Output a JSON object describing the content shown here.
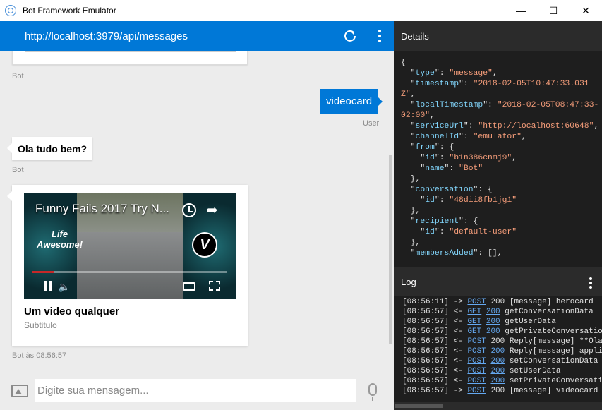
{
  "window": {
    "title": "Bot Framework Emulator",
    "controls": {
      "minimize": "—",
      "maximize": "☐",
      "close": "✕"
    }
  },
  "chat": {
    "url": "http://localhost:3979/api/messages",
    "messages": [
      {
        "from": "Bot",
        "label": "Bot"
      },
      {
        "from": "User",
        "text": "videocard",
        "label": "User"
      },
      {
        "from": "Bot",
        "text": "Ola tudo bem?",
        "label": "Bot"
      },
      {
        "from": "Bot",
        "card": {
          "video_title": "Funny Fails 2017 Try N...",
          "life_text": "Life\nAwesome!",
          "vine_logo": "V",
          "title": "Um video qualquer",
          "subtitle": "Subtitulo"
        },
        "label": "Bot às 08:56:57"
      }
    ],
    "input": {
      "placeholder": "Digite sua mensagem..."
    }
  },
  "details": {
    "title": "Details",
    "json_lines": [
      [
        [
          "p",
          "{"
        ]
      ],
      [
        [
          "p",
          "  \""
        ],
        [
          "k",
          "type"
        ],
        [
          "p",
          "\": "
        ],
        [
          "s",
          "\"message\""
        ],
        [
          "p",
          ","
        ]
      ],
      [
        [
          "p",
          "  \""
        ],
        [
          "k",
          "timestamp"
        ],
        [
          "p",
          "\": "
        ],
        [
          "s",
          "\"2018-02-05T10:47:33.031Z\""
        ],
        [
          "p",
          ","
        ]
      ],
      [
        [
          "p",
          "  \""
        ],
        [
          "k",
          "localTimestamp"
        ],
        [
          "p",
          "\": "
        ],
        [
          "s",
          "\"2018-02-05T08:47:33-02:00\""
        ],
        [
          "p",
          ","
        ]
      ],
      [
        [
          "p",
          "  \""
        ],
        [
          "k",
          "serviceUrl"
        ],
        [
          "p",
          "\": "
        ],
        [
          "s",
          "\"http://localhost:60648\""
        ],
        [
          "p",
          ","
        ]
      ],
      [
        [
          "p",
          "  \""
        ],
        [
          "k",
          "channelId"
        ],
        [
          "p",
          "\": "
        ],
        [
          "s",
          "\"emulator\""
        ],
        [
          "p",
          ","
        ]
      ],
      [
        [
          "p",
          "  \""
        ],
        [
          "k",
          "from"
        ],
        [
          "p",
          "\": {"
        ]
      ],
      [
        [
          "p",
          "    \""
        ],
        [
          "k",
          "id"
        ],
        [
          "p",
          "\": "
        ],
        [
          "s",
          "\"b1n386cnmj9\""
        ],
        [
          "p",
          ","
        ]
      ],
      [
        [
          "p",
          "    \""
        ],
        [
          "k",
          "name"
        ],
        [
          "p",
          "\": "
        ],
        [
          "s",
          "\"Bot\""
        ]
      ],
      [
        [
          "p",
          "  },"
        ]
      ],
      [
        [
          "p",
          "  \""
        ],
        [
          "k",
          "conversation"
        ],
        [
          "p",
          "\": {"
        ]
      ],
      [
        [
          "p",
          "    \""
        ],
        [
          "k",
          "id"
        ],
        [
          "p",
          "\": "
        ],
        [
          "s",
          "\"48dii8fb1jg1\""
        ]
      ],
      [
        [
          "p",
          "  },"
        ]
      ],
      [
        [
          "p",
          "  \""
        ],
        [
          "k",
          "recipient"
        ],
        [
          "p",
          "\": {"
        ]
      ],
      [
        [
          "p",
          "    \""
        ],
        [
          "k",
          "id"
        ],
        [
          "p",
          "\": "
        ],
        [
          "s",
          "\"default-user\""
        ]
      ],
      [
        [
          "p",
          "  },"
        ]
      ],
      [
        [
          "p",
          "  \""
        ],
        [
          "k",
          "membersAdded"
        ],
        [
          "p",
          "\": [],"
        ]
      ]
    ]
  },
  "log": {
    "title": "Log",
    "entries": [
      {
        "time": "[08:56:11]",
        "dir": "->",
        "method": "POST",
        "status": "200",
        "status_link": false,
        "text": "[message] herocard"
      },
      {
        "time": "[08:56:57]",
        "dir": "<-",
        "method": "GET",
        "status": "200",
        "status_link": true,
        "text": "getConversationData"
      },
      {
        "time": "[08:56:57]",
        "dir": "<-",
        "method": "GET",
        "status": "200",
        "status_link": true,
        "text": "getUserData"
      },
      {
        "time": "[08:56:57]",
        "dir": "<-",
        "method": "GET",
        "status": "200",
        "status_link": true,
        "text": "getPrivateConversatio"
      },
      {
        "time": "[08:56:57]",
        "dir": "<-",
        "method": "POST",
        "status": "200",
        "status_link": false,
        "text": "Reply[message] **Ola"
      },
      {
        "time": "[08:56:57]",
        "dir": "<-",
        "method": "POST",
        "status": "200",
        "status_link": true,
        "text": "Reply[message] applic"
      },
      {
        "time": "[08:56:57]",
        "dir": "<-",
        "method": "POST",
        "status": "200",
        "status_link": true,
        "text": "setConversationData"
      },
      {
        "time": "[08:56:57]",
        "dir": "<-",
        "method": "POST",
        "status": "200",
        "status_link": true,
        "text": "setUserData"
      },
      {
        "time": "[08:56:57]",
        "dir": "<-",
        "method": "POST",
        "status": "200",
        "status_link": true,
        "text": "setPrivateConversatio"
      },
      {
        "time": "[08:56:57]",
        "dir": "->",
        "method": "POST",
        "status": "200",
        "status_link": false,
        "text": "[message] videocard"
      }
    ]
  }
}
